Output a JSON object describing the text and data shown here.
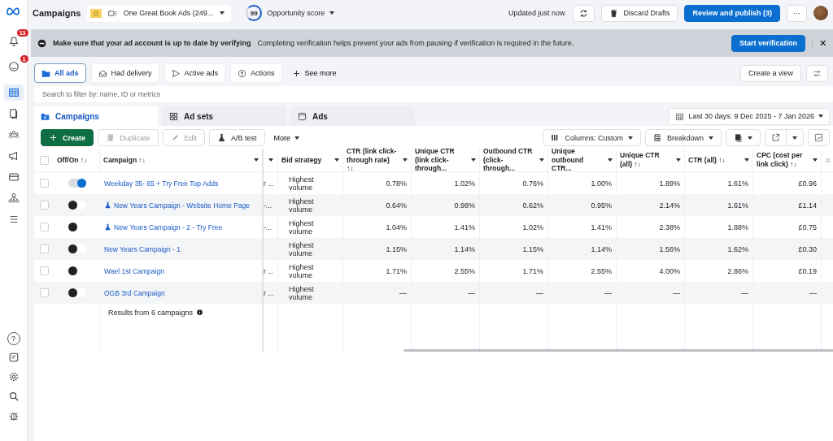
{
  "sidebar": {
    "notifications_badge": "13",
    "profile_badge": "1",
    "items": [
      {
        "selected": true
      },
      {
        "selected": false
      },
      {
        "selected": false
      },
      {
        "selected": false
      },
      {
        "selected": false
      },
      {
        "selected": false
      },
      {
        "selected": false
      }
    ],
    "help": "?"
  },
  "header": {
    "title": "Campaigns",
    "account_badge": "O",
    "account": "One Great Book Ads (249...",
    "score": "99",
    "score_label": "Opportunity score",
    "updated": "Updated just now",
    "discard": "Discard Drafts",
    "publish": "Review and publish (3)",
    "more": "···"
  },
  "banner": {
    "title": "Make sure that your ad account is up to date by verifying",
    "text": "Completing verification helps prevent your ads from pausing if verification is required in the future.",
    "action": "Start verification",
    "close": "✕"
  },
  "filters": [
    {
      "label": "All ads",
      "selected": true
    },
    {
      "label": "Had delivery",
      "selected": false
    },
    {
      "label": "Active ads",
      "selected": false
    },
    {
      "label": "Actions",
      "selected": false
    }
  ],
  "see_more": "See more",
  "create_view": "Create a view",
  "search": {
    "placeholder": "Search to filter by: name, ID or metrics"
  },
  "level_tabs": [
    {
      "label": "Campaigns",
      "selected": true
    },
    {
      "label": "Ad sets",
      "selected": false
    },
    {
      "label": "Ads",
      "selected": false
    }
  ],
  "date_range": "Last 30 days: 9 Dec 2025 - 7 Jan 2026",
  "toolbar": {
    "create": "Create",
    "duplicate": "Duplicate",
    "edit": "Edit",
    "ab_test": "A/B test",
    "more": "More",
    "columns": "Columns: Custom",
    "breakdown": "Breakdown"
  },
  "table": {
    "select_all_checked": false,
    "columns": [
      {
        "label": "Off/On ↑↓"
      },
      {
        "label": "Campaign ↑↓"
      },
      {
        "label": "Bid strategy"
      },
      {
        "label": "CTR (link click-through rate) ↑↓"
      },
      {
        "label": "Unique CTR (link click-through..."
      },
      {
        "label": "Outbound CTR (click-through..."
      },
      {
        "label": "Unique outbound CTR..."
      },
      {
        "label": "Unique CTR (all) ↑↓"
      },
      {
        "label": "CTR (all) ↑↓"
      },
      {
        "label": "CPC (cost per link click) ↑↓"
      }
    ],
    "rows": [
      {
        "checked": false,
        "on": true,
        "ab_test": false,
        "campaign": "Weekday 35- 65 + Try Free Top Adds",
        "column_3": "r ...",
        "bid": "Highest volume",
        "values": [
          "0.78%",
          "1.02%",
          "0.76%",
          "1.00%",
          "1.89%",
          "1.61%",
          "£0.96"
        ]
      },
      {
        "checked": false,
        "on": false,
        "ab_test": true,
        "campaign": "New Years Campaign - Website Home Page",
        "column_3": "-...",
        "bid": "Highest volume",
        "values": [
          "0.64%",
          "0.98%",
          "0.62%",
          "0.95%",
          "2.14%",
          "1.61%",
          "£1.14"
        ]
      },
      {
        "checked": false,
        "on": false,
        "ab_test": true,
        "campaign": "New Years Campaign - 2 - Try Free",
        "column_3": "-...",
        "bid": "Highest volume",
        "values": [
          "1.04%",
          "1.41%",
          "1.02%",
          "1.41%",
          "2.38%",
          "1.88%",
          "£0.75"
        ]
      },
      {
        "checked": false,
        "on": false,
        "ab_test": false,
        "campaign": "New Years Campaign - 1",
        "bid": "Highest volume",
        "values": [
          "1.15%",
          "1.14%",
          "1.15%",
          "1.14%",
          "1.56%",
          "1.62%",
          "£0.30"
        ]
      },
      {
        "checked": false,
        "on": false,
        "ab_test": false,
        "campaign": "Wael 1st Campaign",
        "column_3": "r ...",
        "bid": "Highest volume",
        "values": [
          "1.71%",
          "2.55%",
          "1.71%",
          "2.55%",
          "4.00%",
          "2.86%",
          "£0.19"
        ]
      },
      {
        "checked": false,
        "on": false,
        "ab_test": false,
        "campaign": "OGB 3rd Campaign",
        "column_3": "r ...",
        "bid": "Highest volume",
        "values": [
          "—",
          "—",
          "—",
          "—",
          "—",
          "—",
          "—"
        ]
      }
    ],
    "summary": "Results from 6 campaigns"
  }
}
